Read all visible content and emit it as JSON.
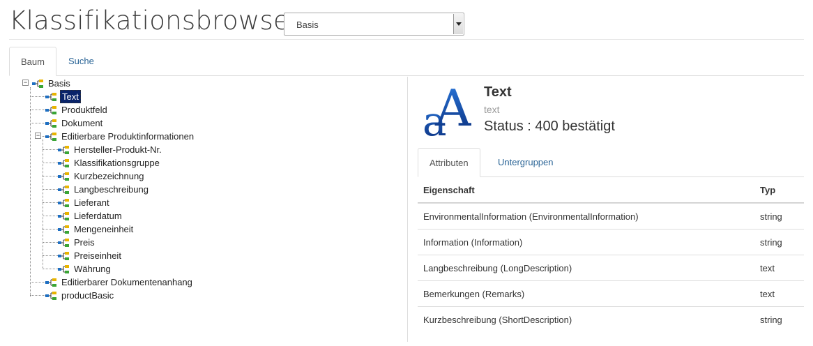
{
  "header": {
    "title": "Klassifikationsbrowser",
    "select_value": "Basis"
  },
  "tabs": [
    {
      "label": "Baum",
      "active": true
    },
    {
      "label": "Suche",
      "active": false
    }
  ],
  "tree": {
    "root": "Basis",
    "children": [
      "Text",
      "Produktfeld",
      "Dokument",
      "Editierbare Produktinformationen",
      "Editierbarer Dokumentenanhang",
      "productBasic"
    ],
    "subchildren": [
      "Hersteller-Produkt-Nr.",
      "Klassifikationsgruppe",
      "Kurzbezeichnung",
      "Langbeschreibung",
      "Lieferant",
      "Lieferdatum",
      "Mengeneinheit",
      "Preis",
      "Preiseinheit",
      "Währung"
    ],
    "selected": "Text"
  },
  "detail": {
    "title": "Text",
    "subtitle": "text",
    "status": "Status : 400 bestätigt",
    "icon": "text-font-icon"
  },
  "detail_tabs": [
    {
      "label": "Attributen",
      "active": true
    },
    {
      "label": "Untergruppen",
      "active": false
    }
  ],
  "table": {
    "headers": [
      "Eigenschaft",
      "Typ"
    ],
    "rows": [
      [
        "EnvironmentalInformation (EnvironmentalInformation)",
        "string"
      ],
      [
        "Information (Information)",
        "string"
      ],
      [
        "Langbeschreibung (LongDescription)",
        "text"
      ],
      [
        "Bemerkungen (Remarks)",
        "text"
      ],
      [
        "Kurzbeschreibung (ShortDescription)",
        "string"
      ]
    ]
  },
  "colors": {
    "link": "#2a6496",
    "selection": "#0a246a",
    "icon_blue": "#1a4fa0"
  }
}
